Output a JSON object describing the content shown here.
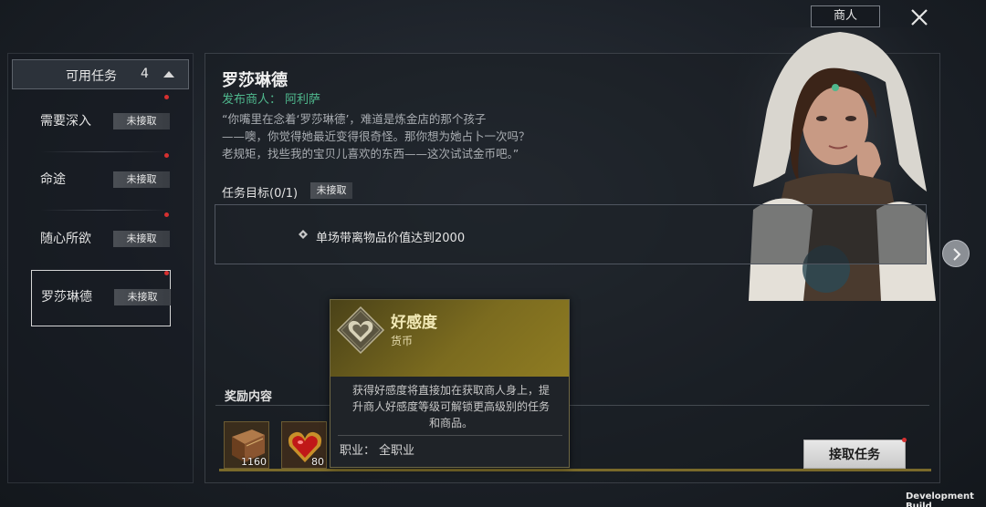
{
  "header": {
    "merchant_tab": "商人",
    "close_icon": "close-icon"
  },
  "sidebar": {
    "title": "可用任务",
    "count": "4",
    "items": [
      {
        "name": "需要深入",
        "status": "未接取"
      },
      {
        "name": "命途",
        "status": "未接取"
      },
      {
        "name": "随心所欲",
        "status": "未接取"
      },
      {
        "name": "罗莎琳德",
        "status": "未接取"
      }
    ]
  },
  "quest": {
    "title": "罗莎琳德",
    "publisher_label": "发布商人：",
    "publisher_name": "阿利萨",
    "description": [
      "“你嘴里在念着‘罗莎琳德’，难道是炼金店的那个孩子",
      "——噢，你觉得她最近变得很奇怪。那你想为她占卜一次吗？",
      "老规矩，找些我的宝贝儿喜欢的东西——这次试试金币吧。”"
    ],
    "objective_label": "任务目标(0/1)",
    "objective_status": "未接取",
    "objective_text": "单场带离物品价值达到2000"
  },
  "rewards": {
    "label": "奖励内容",
    "items": [
      {
        "icon": "book-icon",
        "qty": "1160"
      },
      {
        "icon": "heart-icon",
        "qty": "80"
      }
    ]
  },
  "tooltip": {
    "title": "好感度",
    "subtitle": "货币",
    "body_lines": [
      "获得好感度将直接加在获取商人身上，提",
      "升商人好感度等级可解锁更高级别的任务",
      "和商品。"
    ],
    "job_label": "职业：",
    "job_value": "全职业"
  },
  "accept_button": "接取任务",
  "footer": {
    "dev_build": "Development Build"
  },
  "colors": {
    "publisher": "#4fb88d",
    "tooltip_gold": "#7b6b1f",
    "red_dot": "#d63030"
  }
}
